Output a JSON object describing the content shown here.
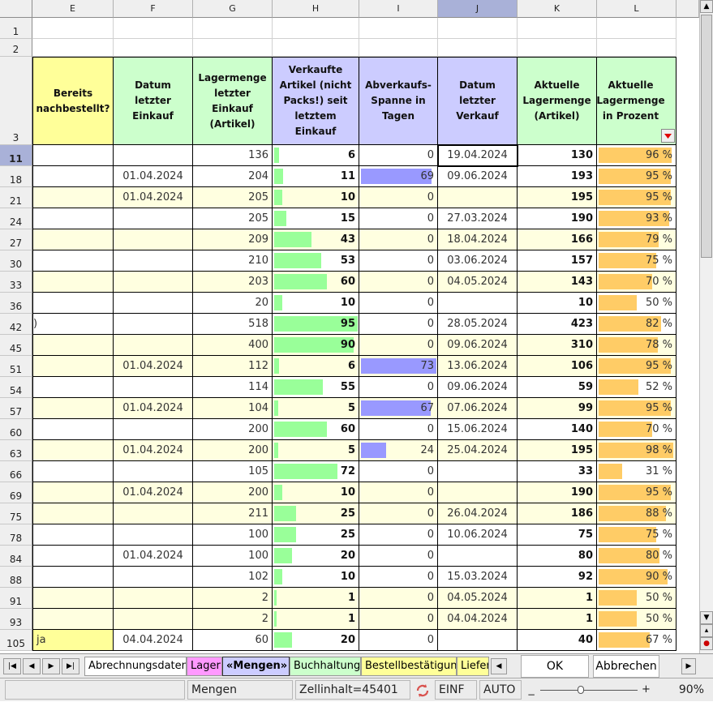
{
  "columns": [
    "E",
    "F",
    "G",
    "H",
    "I",
    "J",
    "K",
    "L"
  ],
  "selected_column": "J",
  "top_rows": [
    "1",
    "2"
  ],
  "header_row_number": "3",
  "headers": {
    "E": "Bereits nachbestellt?",
    "F": "Datum letzter Einkauf",
    "G": "Lagermenge letzter Einkauf (Artikel)",
    "H": "Verkaufte Artikel (nicht Packs!) seit letztem Einkauf",
    "I": "Abverkaufs-Spanne in Tagen",
    "J": "Datum letzter Verkauf",
    "K": "Aktuelle Lagermenge (Artikel)",
    "L": "Aktuelle Lagermenge in Prozent"
  },
  "header_colors": {
    "E": "#ffff99",
    "F": "#ccffcc",
    "G": "#ccffcc",
    "H": "#ccccff",
    "I": "#ccccff",
    "J": "#ccccff",
    "K": "#ccffcc",
    "L": "#ccffcc"
  },
  "bar_colors": {
    "H": "#99ff99",
    "I": "#9999ff",
    "L": "#ffcc66"
  },
  "selected_row": "11",
  "rows": [
    {
      "row": "11",
      "e": "",
      "f": "",
      "g": "136",
      "h": "6",
      "i": "0",
      "j": "19.04.2024",
      "k": "130",
      "l": "96 %",
      "h_frac": 0.06,
      "i_frac": 0,
      "l_frac": 0.96,
      "shade": false
    },
    {
      "row": "18",
      "e": "",
      "f": "01.04.2024",
      "g": "204",
      "h": "11",
      "i": "69",
      "j": "09.06.2024",
      "k": "193",
      "l": "95 %",
      "h_frac": 0.11,
      "i_frac": 0.94,
      "l_frac": 0.95,
      "shade": false
    },
    {
      "row": "21",
      "e": "",
      "f": "01.04.2024",
      "g": "205",
      "h": "10",
      "i": "0",
      "j": "",
      "k": "195",
      "l": "95 %",
      "h_frac": 0.1,
      "i_frac": 0,
      "l_frac": 0.95,
      "shade": true
    },
    {
      "row": "24",
      "e": "",
      "f": "",
      "g": "205",
      "h": "15",
      "i": "0",
      "j": "27.03.2024",
      "k": "190",
      "l": "93 %",
      "h_frac": 0.15,
      "i_frac": 0,
      "l_frac": 0.93,
      "shade": false
    },
    {
      "row": "27",
      "e": "",
      "f": "",
      "g": "209",
      "h": "43",
      "i": "0",
      "j": "18.04.2024",
      "k": "166",
      "l": "79 %",
      "h_frac": 0.45,
      "i_frac": 0,
      "l_frac": 0.79,
      "shade": true
    },
    {
      "row": "30",
      "e": "",
      "f": "",
      "g": "210",
      "h": "53",
      "i": "0",
      "j": "03.06.2024",
      "k": "157",
      "l": "75 %",
      "h_frac": 0.56,
      "i_frac": 0,
      "l_frac": 0.75,
      "shade": false
    },
    {
      "row": "33",
      "e": "",
      "f": "",
      "g": "203",
      "h": "60",
      "i": "0",
      "j": "04.05.2024",
      "k": "143",
      "l": "70 %",
      "h_frac": 0.63,
      "i_frac": 0,
      "l_frac": 0.7,
      "shade": true
    },
    {
      "row": "36",
      "e": "",
      "f": "",
      "g": "20",
      "h": "10",
      "i": "0",
      "j": "",
      "k": "10",
      "l": "50 %",
      "h_frac": 0.1,
      "i_frac": 0,
      "l_frac": 0.5,
      "shade": false
    },
    {
      "row": "42",
      "e": ")",
      "f": "",
      "g": "518",
      "h": "95",
      "i": "0",
      "j": "28.05.2024",
      "k": "423",
      "l": "82 %",
      "h_frac": 1.0,
      "i_frac": 0,
      "l_frac": 0.82,
      "shade": false
    },
    {
      "row": "45",
      "e": "",
      "f": "",
      "g": "400",
      "h": "90",
      "i": "0",
      "j": "09.06.2024",
      "k": "310",
      "l": "78 %",
      "h_frac": 0.95,
      "i_frac": 0,
      "l_frac": 0.78,
      "shade": true
    },
    {
      "row": "51",
      "e": "",
      "f": "01.04.2024",
      "g": "112",
      "h": "6",
      "i": "73",
      "j": "13.06.2024",
      "k": "106",
      "l": "95 %",
      "h_frac": 0.06,
      "i_frac": 1.0,
      "l_frac": 0.95,
      "shade": true
    },
    {
      "row": "54",
      "e": "",
      "f": "",
      "g": "114",
      "h": "55",
      "i": "0",
      "j": "09.06.2024",
      "k": "59",
      "l": "52 %",
      "h_frac": 0.58,
      "i_frac": 0,
      "l_frac": 0.52,
      "shade": false
    },
    {
      "row": "57",
      "e": "",
      "f": "01.04.2024",
      "g": "104",
      "h": "5",
      "i": "67",
      "j": "07.06.2024",
      "k": "99",
      "l": "95 %",
      "h_frac": 0.05,
      "i_frac": 0.92,
      "l_frac": 0.95,
      "shade": true
    },
    {
      "row": "60",
      "e": "",
      "f": "",
      "g": "200",
      "h": "60",
      "i": "0",
      "j": "15.06.2024",
      "k": "140",
      "l": "70 %",
      "h_frac": 0.63,
      "i_frac": 0,
      "l_frac": 0.7,
      "shade": false
    },
    {
      "row": "63",
      "e": "",
      "f": "01.04.2024",
      "g": "200",
      "h": "5",
      "i": "24",
      "j": "25.04.2024",
      "k": "195",
      "l": "98 %",
      "h_frac": 0.05,
      "i_frac": 0.33,
      "l_frac": 0.98,
      "shade": true
    },
    {
      "row": "66",
      "e": "",
      "f": "",
      "g": "105",
      "h": "72",
      "i": "0",
      "j": "",
      "k": "33",
      "l": "31 %",
      "h_frac": 0.76,
      "i_frac": 0,
      "l_frac": 0.31,
      "shade": false
    },
    {
      "row": "69",
      "e": "",
      "f": "01.04.2024",
      "g": "200",
      "h": "10",
      "i": "0",
      "j": "",
      "k": "190",
      "l": "95 %",
      "h_frac": 0.1,
      "i_frac": 0,
      "l_frac": 0.95,
      "shade": true
    },
    {
      "row": "75",
      "e": "",
      "f": "",
      "g": "211",
      "h": "25",
      "i": "0",
      "j": "26.04.2024",
      "k": "186",
      "l": "88 %",
      "h_frac": 0.26,
      "i_frac": 0,
      "l_frac": 0.88,
      "shade": true
    },
    {
      "row": "78",
      "e": "",
      "f": "",
      "g": "100",
      "h": "25",
      "i": "0",
      "j": "10.06.2024",
      "k": "75",
      "l": "75 %",
      "h_frac": 0.26,
      "i_frac": 0,
      "l_frac": 0.75,
      "shade": false
    },
    {
      "row": "84",
      "e": "",
      "f": "01.04.2024",
      "g": "100",
      "h": "20",
      "i": "0",
      "j": "",
      "k": "80",
      "l": "80 %",
      "h_frac": 0.21,
      "i_frac": 0,
      "l_frac": 0.8,
      "shade": false
    },
    {
      "row": "88",
      "e": "",
      "f": "",
      "g": "102",
      "h": "10",
      "i": "0",
      "j": "15.03.2024",
      "k": "92",
      "l": "90 %",
      "h_frac": 0.1,
      "i_frac": 0,
      "l_frac": 0.9,
      "shade": false
    },
    {
      "row": "91",
      "e": "",
      "f": "",
      "g": "2",
      "h": "1",
      "i": "0",
      "j": "04.05.2024",
      "k": "1",
      "l": "50 %",
      "h_frac": 0.02,
      "i_frac": 0,
      "l_frac": 0.5,
      "shade": true
    },
    {
      "row": "93",
      "e": "",
      "f": "",
      "g": "2",
      "h": "1",
      "i": "0",
      "j": "04.04.2024",
      "k": "1",
      "l": "50 %",
      "h_frac": 0.02,
      "i_frac": 0,
      "l_frac": 0.5,
      "shade": true
    },
    {
      "row": "105",
      "e": "ja",
      "f": "04.04.2024",
      "g": "60",
      "h": "20",
      "i": "0",
      "j": "",
      "k": "40",
      "l": "67 %",
      "h_frac": 0.21,
      "i_frac": 0,
      "l_frac": 0.67,
      "shade": false
    }
  ],
  "tabs": [
    {
      "label": "Abrechnungsdaten",
      "bg": "#ffffff",
      "active": false
    },
    {
      "label": "Lager",
      "bg": "#ff99ff",
      "active": false
    },
    {
      "label": "«Mengen»",
      "bg": "#ccccff",
      "active": true
    },
    {
      "label": "Buchhaltung",
      "bg": "#ccffcc",
      "active": false
    },
    {
      "label": "Bestellbestätigung",
      "bg": "#ffff99",
      "active": false
    },
    {
      "label": "Liefer",
      "bg": "#ffff99",
      "active": false
    }
  ],
  "dialog_buttons": {
    "ok": "OK",
    "cancel": "Abbrechen"
  },
  "status": {
    "sheet": "Mengen",
    "cell_content": "Zellinhalt=45401",
    "insert_mode": "EINF",
    "selection_mode": "AUTO",
    "zoom": "90%"
  },
  "colors": {
    "shaded_row": "#ffffe0",
    "e_ja": "#ffff99",
    "selection_highlight": "#a9b1d8"
  }
}
